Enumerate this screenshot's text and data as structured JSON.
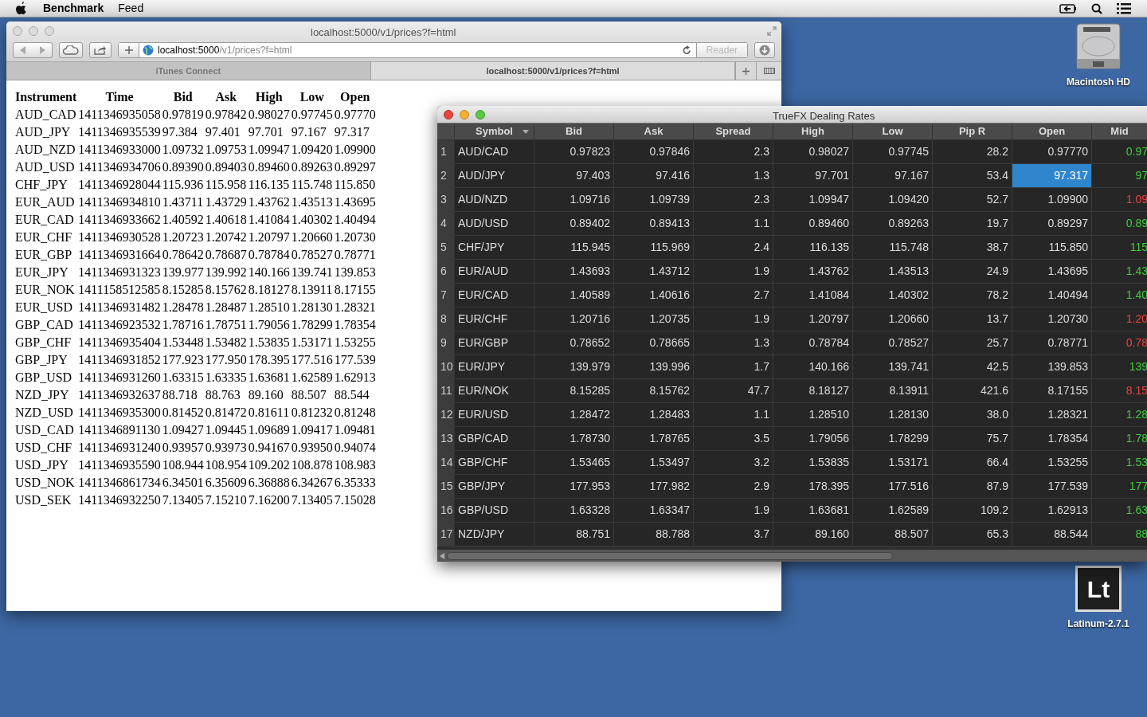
{
  "menu_bar": {
    "app": "Benchmark",
    "items": [
      "Feed"
    ]
  },
  "browser": {
    "title": "localhost:5000/v1/prices?f=html",
    "url_host": "localhost:5000",
    "url_path": "/v1/prices?f=html",
    "reader": "Reader",
    "tabs": [
      {
        "label": "iTunes Connect",
        "selected": false
      },
      {
        "label": "localhost:5000/v1/prices?f=html",
        "selected": true
      }
    ],
    "table": {
      "columns": [
        "Instrument",
        "Time",
        "Bid",
        "Ask",
        "High",
        "Low",
        "Open"
      ],
      "rows": [
        [
          "AUD_CAD",
          "1411346935058",
          "0.97819",
          "0.97842",
          "0.98027",
          "0.97745",
          "0.97770"
        ],
        [
          "AUD_JPY",
          "1411346935539",
          "97.384",
          "97.401",
          "97.701",
          "97.167",
          "97.317"
        ],
        [
          "AUD_NZD",
          "1411346933000",
          "1.09732",
          "1.09753",
          "1.09947",
          "1.09420",
          "1.09900"
        ],
        [
          "AUD_USD",
          "1411346934706",
          "0.89390",
          "0.89403",
          "0.89460",
          "0.89263",
          "0.89297"
        ],
        [
          "CHF_JPY",
          "1411346928044",
          "115.936",
          "115.958",
          "116.135",
          "115.748",
          "115.850"
        ],
        [
          "EUR_AUD",
          "1411346934810",
          "1.43711",
          "1.43729",
          "1.43762",
          "1.43513",
          "1.43695"
        ],
        [
          "EUR_CAD",
          "1411346933662",
          "1.40592",
          "1.40618",
          "1.41084",
          "1.40302",
          "1.40494"
        ],
        [
          "EUR_CHF",
          "1411346930528",
          "1.20723",
          "1.20742",
          "1.20797",
          "1.20660",
          "1.20730"
        ],
        [
          "EUR_GBP",
          "1411346931664",
          "0.78642",
          "0.78687",
          "0.78784",
          "0.78527",
          "0.78771"
        ],
        [
          "EUR_JPY",
          "1411346931323",
          "139.977",
          "139.992",
          "140.166",
          "139.741",
          "139.853"
        ],
        [
          "EUR_NOK",
          "1411158512585",
          "8.15285",
          "8.15762",
          "8.18127",
          "8.13911",
          "8.17155"
        ],
        [
          "EUR_USD",
          "1411346931482",
          "1.28478",
          "1.28487",
          "1.28510",
          "1.28130",
          "1.28321"
        ],
        [
          "GBP_CAD",
          "1411346923532",
          "1.78716",
          "1.78751",
          "1.79056",
          "1.78299",
          "1.78354"
        ],
        [
          "GBP_CHF",
          "1411346935404",
          "1.53448",
          "1.53482",
          "1.53835",
          "1.53171",
          "1.53255"
        ],
        [
          "GBP_JPY",
          "1411346931852",
          "177.923",
          "177.950",
          "178.395",
          "177.516",
          "177.539"
        ],
        [
          "GBP_USD",
          "1411346931260",
          "1.63315",
          "1.63335",
          "1.63681",
          "1.62589",
          "1.62913"
        ],
        [
          "NZD_JPY",
          "1411346932637",
          "88.718",
          "88.763",
          "89.160",
          "88.507",
          "88.544"
        ],
        [
          "NZD_USD",
          "1411346935300",
          "0.81452",
          "0.81472",
          "0.81611",
          "0.81232",
          "0.81248"
        ],
        [
          "USD_CAD",
          "1411346891130",
          "1.09427",
          "1.09445",
          "1.09689",
          "1.09417",
          "1.09481"
        ],
        [
          "USD_CHF",
          "1411346931240",
          "0.93957",
          "0.93973",
          "0.94167",
          "0.93950",
          "0.94074"
        ],
        [
          "USD_JPY",
          "1411346935590",
          "108.944",
          "108.954",
          "109.202",
          "108.878",
          "108.983"
        ],
        [
          "USD_NOK",
          "1411346861734",
          "6.34501",
          "6.35609",
          "6.36888",
          "6.34267",
          "6.35333"
        ],
        [
          "USD_SEK",
          "1411346932250",
          "7.13405",
          "7.15210",
          "7.16200",
          "7.13405",
          "7.15028"
        ]
      ]
    }
  },
  "rates_window": {
    "title": "TrueFX Dealing Rates",
    "columns": [
      "Symbol",
      "Bid",
      "Ask",
      "Spread",
      "High",
      "Low",
      "Pip R",
      "Open",
      "Mid"
    ],
    "rows": [
      {
        "num": "1",
        "symbol": "AUD/CAD",
        "bid": "0.97823",
        "ask": "0.97846",
        "spread": "2.3",
        "high": "0.98027",
        "low": "0.97745",
        "pip": "28.2",
        "open": "0.97770",
        "open_selected": false,
        "mid": "0.97",
        "color": "#3fcf3f"
      },
      {
        "num": "2",
        "symbol": "AUD/JPY",
        "bid": "97.403",
        "ask": "97.416",
        "spread": "1.3",
        "high": "97.701",
        "low": "97.167",
        "pip": "53.4",
        "open": "97.317",
        "open_selected": true,
        "mid": "97",
        "color": "#3fcf3f"
      },
      {
        "num": "3",
        "symbol": "AUD/NZD",
        "bid": "1.09716",
        "ask": "1.09739",
        "spread": "2.3",
        "high": "1.09947",
        "low": "1.09420",
        "pip": "52.7",
        "open": "1.09900",
        "open_selected": false,
        "mid": "1.09",
        "color": "#f04040"
      },
      {
        "num": "4",
        "symbol": "AUD/USD",
        "bid": "0.89402",
        "ask": "0.89413",
        "spread": "1.1",
        "high": "0.89460",
        "low": "0.89263",
        "pip": "19.7",
        "open": "0.89297",
        "open_selected": false,
        "mid": "0.89",
        "color": "#3fcf3f"
      },
      {
        "num": "5",
        "symbol": "CHF/JPY",
        "bid": "115.945",
        "ask": "115.969",
        "spread": "2.4",
        "high": "116.135",
        "low": "115.748",
        "pip": "38.7",
        "open": "115.850",
        "open_selected": false,
        "mid": "115",
        "color": "#3fcf3f"
      },
      {
        "num": "6",
        "symbol": "EUR/AUD",
        "bid": "1.43693",
        "ask": "1.43712",
        "spread": "1.9",
        "high": "1.43762",
        "low": "1.43513",
        "pip": "24.9",
        "open": "1.43695",
        "open_selected": false,
        "mid": "1.43",
        "color": "#3fcf3f"
      },
      {
        "num": "7",
        "symbol": "EUR/CAD",
        "bid": "1.40589",
        "ask": "1.40616",
        "spread": "2.7",
        "high": "1.41084",
        "low": "1.40302",
        "pip": "78.2",
        "open": "1.40494",
        "open_selected": false,
        "mid": "1.40",
        "color": "#3fcf3f"
      },
      {
        "num": "8",
        "symbol": "EUR/CHF",
        "bid": "1.20716",
        "ask": "1.20735",
        "spread": "1.9",
        "high": "1.20797",
        "low": "1.20660",
        "pip": "13.7",
        "open": "1.20730",
        "open_selected": false,
        "mid": "1.20",
        "color": "#f04040"
      },
      {
        "num": "9",
        "symbol": "EUR/GBP",
        "bid": "0.78652",
        "ask": "0.78665",
        "spread": "1.3",
        "high": "0.78784",
        "low": "0.78527",
        "pip": "25.7",
        "open": "0.78771",
        "open_selected": false,
        "mid": "0.78",
        "color": "#f04040"
      },
      {
        "num": "10",
        "symbol": "EUR/JPY",
        "bid": "139.979",
        "ask": "139.996",
        "spread": "1.7",
        "high": "140.166",
        "low": "139.741",
        "pip": "42.5",
        "open": "139.853",
        "open_selected": false,
        "mid": "139",
        "color": "#3fcf3f"
      },
      {
        "num": "11",
        "symbol": "EUR/NOK",
        "bid": "8.15285",
        "ask": "8.15762",
        "spread": "47.7",
        "high": "8.18127",
        "low": "8.13911",
        "pip": "421.6",
        "open": "8.17155",
        "open_selected": false,
        "mid": "8.15",
        "color": "#f04040"
      },
      {
        "num": "12",
        "symbol": "EUR/USD",
        "bid": "1.28472",
        "ask": "1.28483",
        "spread": "1.1",
        "high": "1.28510",
        "low": "1.28130",
        "pip": "38.0",
        "open": "1.28321",
        "open_selected": false,
        "mid": "1.28",
        "color": "#3fcf3f"
      },
      {
        "num": "13",
        "symbol": "GBP/CAD",
        "bid": "1.78730",
        "ask": "1.78765",
        "spread": "3.5",
        "high": "1.79056",
        "low": "1.78299",
        "pip": "75.7",
        "open": "1.78354",
        "open_selected": false,
        "mid": "1.78",
        "color": "#3fcf3f"
      },
      {
        "num": "14",
        "symbol": "GBP/CHF",
        "bid": "1.53465",
        "ask": "1.53497",
        "spread": "3.2",
        "high": "1.53835",
        "low": "1.53171",
        "pip": "66.4",
        "open": "1.53255",
        "open_selected": false,
        "mid": "1.53",
        "color": "#3fcf3f"
      },
      {
        "num": "15",
        "symbol": "GBP/JPY",
        "bid": "177.953",
        "ask": "177.982",
        "spread": "2.9",
        "high": "178.395",
        "low": "177.516",
        "pip": "87.9",
        "open": "177.539",
        "open_selected": false,
        "mid": "177",
        "color": "#3fcf3f"
      },
      {
        "num": "16",
        "symbol": "GBP/USD",
        "bid": "1.63328",
        "ask": "1.63347",
        "spread": "1.9",
        "high": "1.63681",
        "low": "1.62589",
        "pip": "109.2",
        "open": "1.62913",
        "open_selected": false,
        "mid": "1.63",
        "color": "#3fcf3f"
      },
      {
        "num": "17",
        "symbol": "NZD/JPY",
        "bid": "88.751",
        "ask": "88.788",
        "spread": "3.7",
        "high": "89.160",
        "low": "88.507",
        "pip": "65.3",
        "open": "88.544",
        "open_selected": false,
        "mid": "88",
        "color": "#3fcf3f"
      }
    ]
  },
  "desktop_icons": [
    {
      "kind": "disk",
      "label": "Macintosh HD"
    },
    {
      "kind": "app",
      "glyph": "Lt",
      "label": "Latinum-2.7.1"
    }
  ]
}
